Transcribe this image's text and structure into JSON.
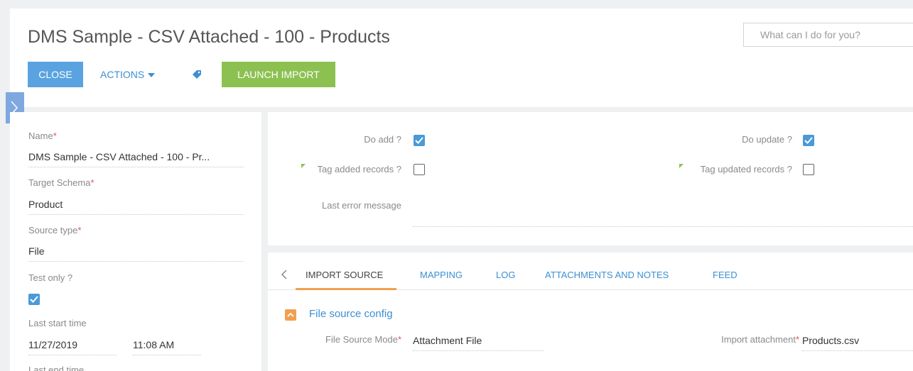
{
  "header": {
    "title": "DMS Sample - CSV Attached - 100 - Products",
    "search_placeholder": "What can I do for you?",
    "close_label": "CLOSE",
    "actions_label": "ACTIONS",
    "launch_label": "LAUNCH IMPORT"
  },
  "left_panel": {
    "name_label": "Name",
    "name_value": "DMS Sample - CSV Attached - 100 - Pr...",
    "schema_label": "Target Schema",
    "schema_value": "Product",
    "source_type_label": "Source type",
    "source_type_value": "File",
    "test_only_label": "Test only ?",
    "test_only_checked": true,
    "last_start_label": "Last start time",
    "last_start_date": "11/27/2019",
    "last_start_time": "11:08 AM",
    "last_end_label": "Last end time",
    "required_mark": "*"
  },
  "options": {
    "do_add_label": "Do add ?",
    "do_add_checked": true,
    "do_update_label": "Do update ?",
    "do_update_checked": true,
    "tag_added_label": "Tag added records ?",
    "tag_added_checked": false,
    "tag_updated_label": "Tag updated records ?",
    "tag_updated_checked": false,
    "last_error_label": "Last error message"
  },
  "tabs": [
    {
      "label": "IMPORT SOURCE",
      "active": true
    },
    {
      "label": "MAPPING",
      "active": false
    },
    {
      "label": "LOG",
      "active": false
    },
    {
      "label": "ATTACHMENTS AND NOTES",
      "active": false
    },
    {
      "label": "FEED",
      "active": false
    }
  ],
  "section": {
    "title": "File source config",
    "file_source_mode_label": "File Source Mode",
    "file_source_mode_value": "Attachment File",
    "import_attachment_label": "Import attachment",
    "import_attachment_value": "Products.csv"
  },
  "colors": {
    "primary": "#5aa3e0",
    "link": "#3d8fd1",
    "success": "#8cc152",
    "accent": "#f0a050",
    "required": "#e05555"
  }
}
